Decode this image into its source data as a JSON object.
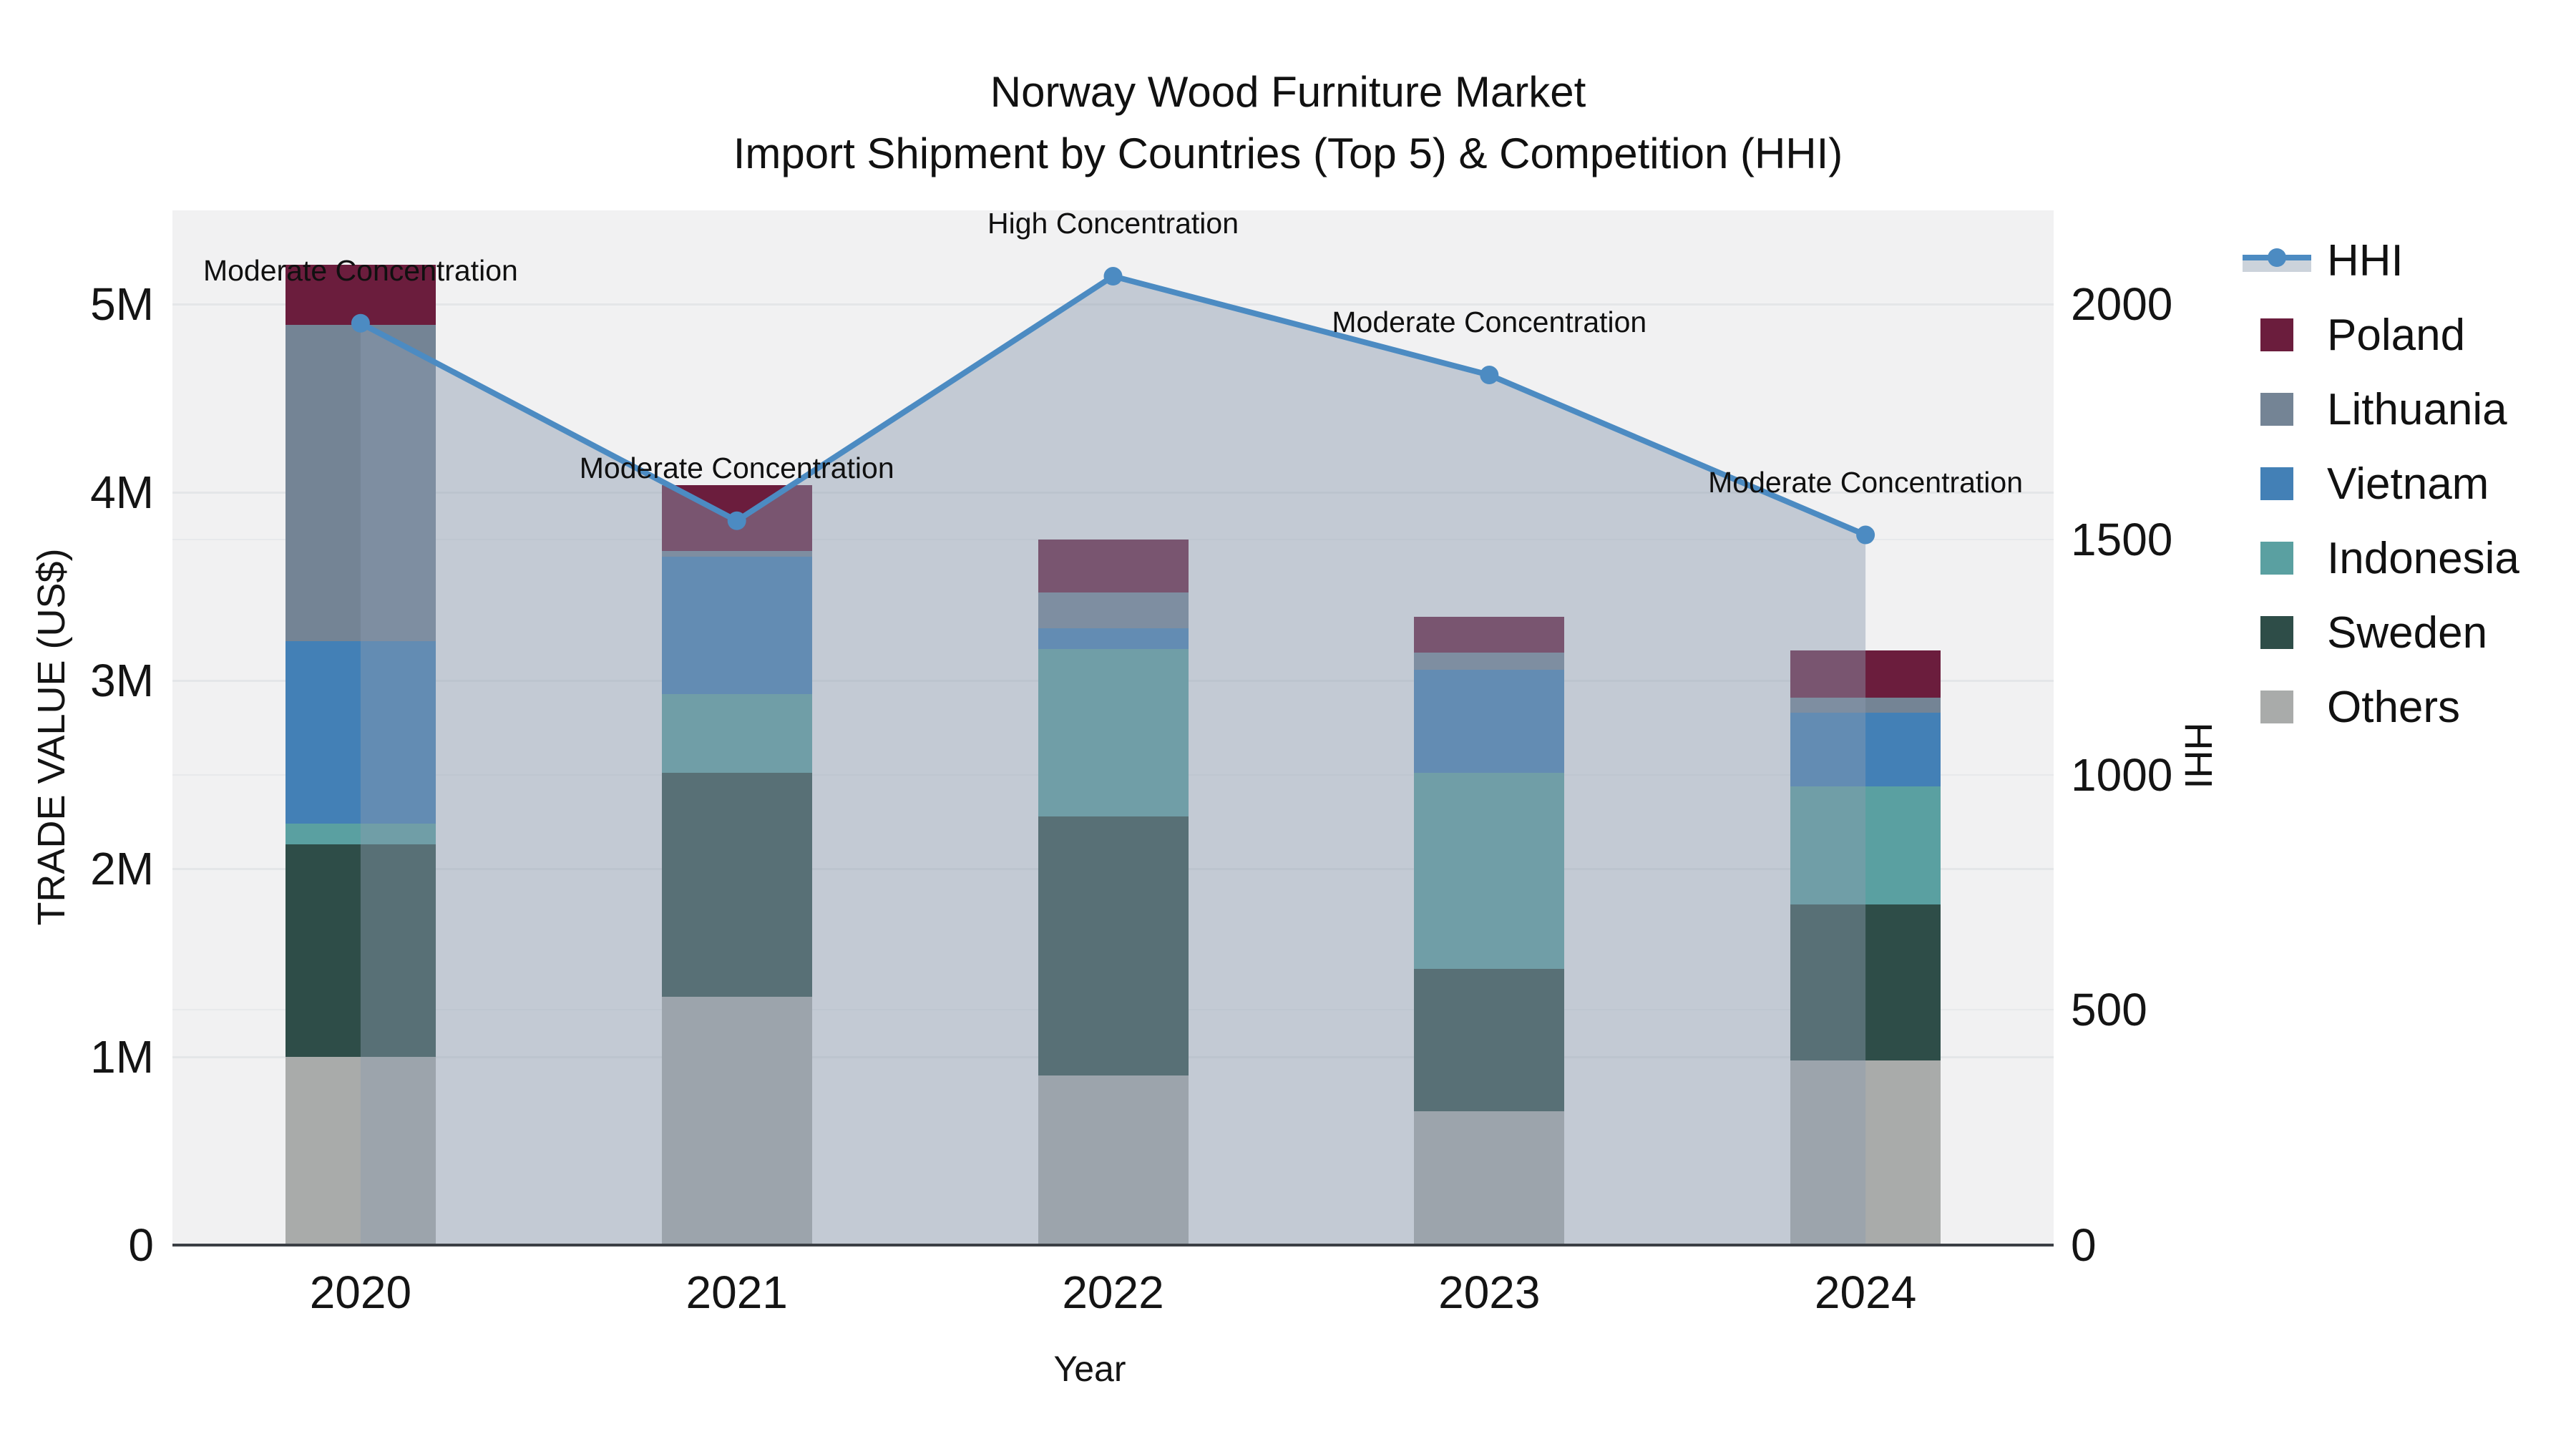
{
  "title": {
    "line1": "Norway Wood Furniture Market",
    "line2": "Import Shipment by Countries (Top 5) & Competition (HHI)"
  },
  "axes": {
    "x": {
      "title": "Year",
      "categories": [
        "2020",
        "2021",
        "2022",
        "2023",
        "2024"
      ]
    },
    "y_left": {
      "title": "TRADE VALUE (US$)",
      "max": 5500000,
      "ticks": [
        {
          "value": 0,
          "label": "0"
        },
        {
          "value": 1000000,
          "label": "1M"
        },
        {
          "value": 2000000,
          "label": "2M"
        },
        {
          "value": 3000000,
          "label": "3M"
        },
        {
          "value": 4000000,
          "label": "4M"
        },
        {
          "value": 5000000,
          "label": "5M"
        }
      ]
    },
    "y_right": {
      "title": "HHI",
      "max": 2200,
      "ticks": [
        {
          "value": 0,
          "label": "0"
        },
        {
          "value": 500,
          "label": "500"
        },
        {
          "value": 1000,
          "label": "1000"
        },
        {
          "value": 1500,
          "label": "1500"
        },
        {
          "value": 2000,
          "label": "2000"
        }
      ]
    }
  },
  "chart_data": {
    "type": "bar",
    "subtype": "stacked-bars-with-line",
    "categories": [
      "2020",
      "2021",
      "2022",
      "2023",
      "2024"
    ],
    "stack_order_bottom_to_top": [
      "Others",
      "Sweden",
      "Indonesia",
      "Vietnam",
      "Lithuania",
      "Poland"
    ],
    "series": [
      {
        "name": "Others",
        "values": [
          1000000,
          1320000,
          900000,
          710000,
          980000
        ]
      },
      {
        "name": "Sweden",
        "values": [
          1130000,
          1190000,
          1380000,
          760000,
          830000
        ]
      },
      {
        "name": "Indonesia",
        "values": [
          110000,
          420000,
          890000,
          1040000,
          630000
        ]
      },
      {
        "name": "Vietnam",
        "values": [
          970000,
          730000,
          110000,
          550000,
          390000
        ]
      },
      {
        "name": "Lithuania",
        "values": [
          1680000,
          30000,
          190000,
          90000,
          80000
        ]
      },
      {
        "name": "Poland",
        "values": [
          320000,
          350000,
          280000,
          190000,
          250000
        ]
      }
    ],
    "line_series": {
      "name": "HHI",
      "axis": "right",
      "values": [
        1960,
        1540,
        2060,
        1850,
        1510
      ],
      "area_fill": true
    },
    "annotations": [
      "Moderate Concentration",
      "Moderate Concentration",
      "High Concentration",
      "Moderate Concentration",
      "Moderate Concentration"
    ],
    "title": "Norway Wood Furniture Market Import Shipment by Countries (Top 5) & Competition (HHI)",
    "xlabel": "Year",
    "ylabel_left": "TRADE VALUE (US$)",
    "ylabel_right": "HHI",
    "ylim_left": [
      0,
      5500000
    ],
    "ylim_right": [
      0,
      2200
    ],
    "grid": true,
    "legend_position": "right"
  },
  "legend": {
    "items": [
      {
        "label": "HHI",
        "swatch": "hhi"
      },
      {
        "label": "Poland",
        "swatch": "poland"
      },
      {
        "label": "Lithuania",
        "swatch": "lithuania"
      },
      {
        "label": "Vietnam",
        "swatch": "vietnam"
      },
      {
        "label": "Indonesia",
        "swatch": "indonesia"
      },
      {
        "label": "Sweden",
        "swatch": "sweden"
      },
      {
        "label": "Others",
        "swatch": "others"
      }
    ]
  },
  "colors": {
    "poland": "#6b1d3d",
    "lithuania": "#748495",
    "vietnam": "#4380b6",
    "indonesia": "#5aa0a1",
    "sweden": "#2e4d48",
    "others": "#a9abaa",
    "hhi_line": "#4c8bc2",
    "area_fill": "rgba(139,155,175,0.45)",
    "plot_bg": "#f1f1f2",
    "axis_line": "#3b3f45",
    "gridline": "#e4e6e8"
  }
}
